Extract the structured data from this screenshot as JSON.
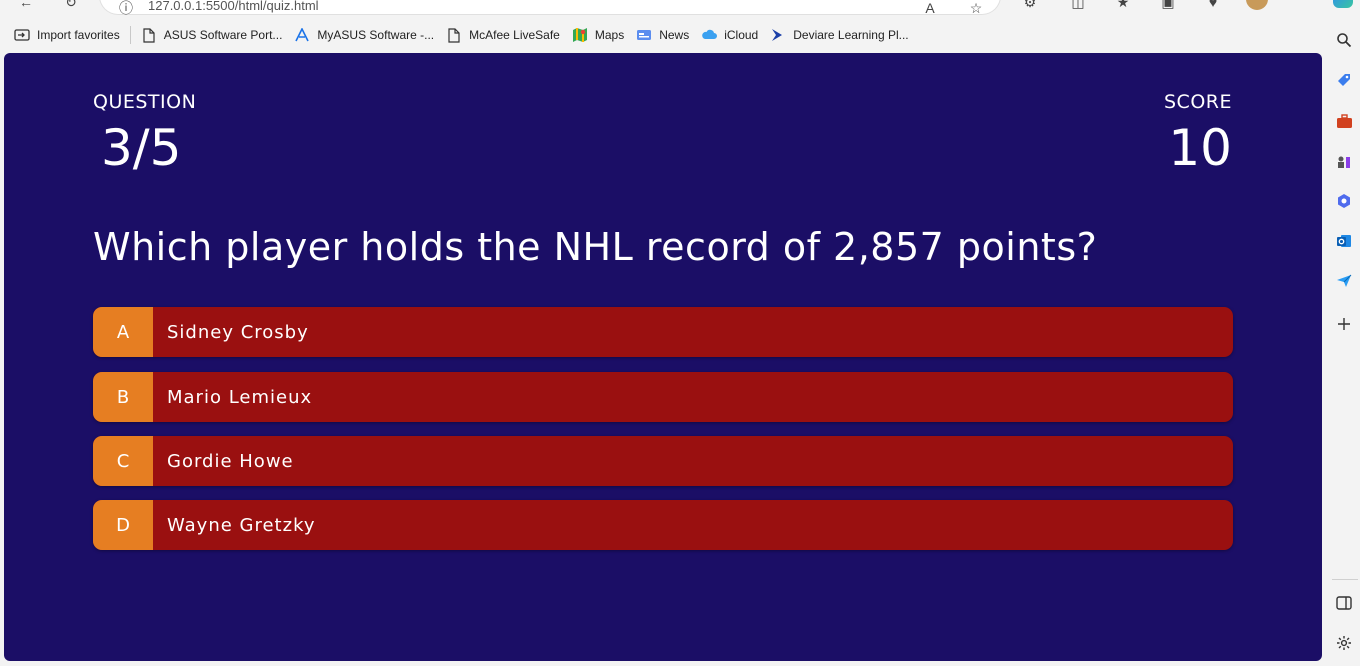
{
  "browser": {
    "url": "127.0.0.1:5500/html/quiz.html",
    "bookmarks": [
      {
        "label": "Import favorites",
        "icon": "import-icon"
      },
      {
        "label": "ASUS Software Port...",
        "icon": "page-icon"
      },
      {
        "label": "MyASUS Software -...",
        "icon": "myasus-icon"
      },
      {
        "label": "McAfee LiveSafe",
        "icon": "page-icon"
      },
      {
        "label": "Maps",
        "icon": "maps-icon"
      },
      {
        "label": "News",
        "icon": "news-icon"
      },
      {
        "label": "iCloud",
        "icon": "cloud-icon"
      },
      {
        "label": "Deviare Learning Pl...",
        "icon": "deviare-icon"
      }
    ]
  },
  "quiz": {
    "question_label": "QUESTION",
    "progress": "3/5",
    "score_label": "SCORE",
    "score": "10",
    "question": "Which player holds the NHL record of 2,857 points?",
    "choices": [
      {
        "prefix": "A",
        "text": "Sidney Crosby"
      },
      {
        "prefix": "B",
        "text": "Mario Lemieux"
      },
      {
        "prefix": "C",
        "text": "Gordie Howe"
      },
      {
        "prefix": "D",
        "text": "Wayne Gretzky"
      }
    ]
  },
  "colors": {
    "page_bg": "#1b0e66",
    "choice_bg": "#9a1010",
    "prefix_bg": "#e67e22"
  }
}
